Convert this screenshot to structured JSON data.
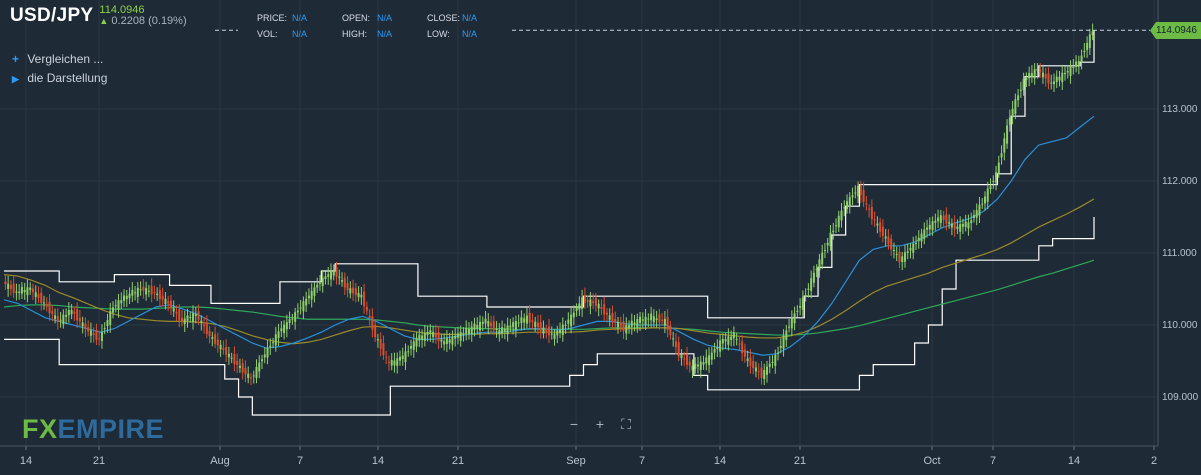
{
  "header": {
    "symbol": "USD/JPY",
    "last_price": "114.0946",
    "change": "0.2208 (0.19%)",
    "fields": [
      {
        "label": "PRICE:",
        "value": "N/A"
      },
      {
        "label": "OPEN:",
        "value": "N/A"
      },
      {
        "label": "CLOSE:",
        "value": "N/A"
      },
      {
        "label": "VOL:",
        "value": "N/A"
      },
      {
        "label": "HIGH:",
        "value": "N/A"
      },
      {
        "label": "LOW:",
        "value": "N/A"
      }
    ]
  },
  "menu": {
    "compare": "Vergleichen ...",
    "display": "die Darstellung"
  },
  "logo": {
    "fx": "FX",
    "empire": "EMPIRE"
  },
  "zoom": {
    "minus": "−",
    "plus": "+",
    "fullscreen": "⛶"
  },
  "price_tag": "114.0946",
  "colors": {
    "background": "#1e2a36",
    "up": "#8fcf6a",
    "down": "#d9502f",
    "ma_fast": "#2c8fd6",
    "ma_mid": "#9a8a2c",
    "ma_slow": "#2fa85a",
    "channel": "#ffffff",
    "accent": "#6dbb45"
  },
  "chart_data": {
    "type": "candlestick",
    "title": "USD/JPY",
    "y_ticks": [
      "109.000",
      "110.000",
      "111.000",
      "112.000",
      "113.000"
    ],
    "y_range": [
      108.5,
      114.3
    ],
    "x_ticks": [
      "14",
      "21",
      "Aug",
      "7",
      "14",
      "21",
      "Sep",
      "7",
      "14",
      "21",
      "Oct",
      "7",
      "14",
      "2"
    ],
    "last": 114.0946,
    "grid": true,
    "series": [
      {
        "name": "Close",
        "values": [
          110.6,
          110.45,
          110.5,
          110.3,
          110.05,
          110.2,
          109.95,
          109.8,
          110.25,
          110.4,
          110.5,
          110.45,
          110.3,
          110.05,
          110.15,
          109.85,
          109.65,
          109.45,
          109.25,
          109.6,
          109.9,
          110.1,
          110.35,
          110.6,
          110.75,
          110.5,
          110.4,
          109.85,
          109.45,
          109.55,
          109.8,
          109.9,
          109.75,
          109.85,
          109.95,
          110.05,
          109.9,
          110.0,
          110.1,
          109.95,
          109.85,
          110.05,
          110.35,
          110.3,
          110.1,
          109.95,
          110.05,
          110.1,
          110.05,
          109.6,
          109.4,
          109.5,
          109.75,
          109.85,
          109.5,
          109.3,
          109.55,
          110.0,
          110.35,
          110.8,
          111.25,
          111.65,
          111.9,
          111.5,
          111.2,
          110.9,
          111.1,
          111.35,
          111.5,
          111.35,
          111.4,
          111.7,
          112.1,
          112.9,
          113.4,
          113.55,
          113.35,
          113.5,
          113.65,
          114.09
        ]
      },
      {
        "name": "MA fast",
        "values": [
          110.35,
          110.3,
          110.2,
          110.1,
          110.05,
          110.0,
          109.95,
          109.9,
          109.95,
          110.05,
          110.15,
          110.25,
          110.28,
          110.22,
          110.15,
          110.05,
          109.95,
          109.85,
          109.75,
          109.68,
          109.7,
          109.75,
          109.82,
          109.9,
          110.0,
          110.08,
          110.12,
          110.05,
          109.95,
          109.85,
          109.8,
          109.8,
          109.82,
          109.85,
          109.88,
          109.9,
          109.9,
          109.92,
          109.95,
          109.95,
          109.93,
          109.95,
          110.0,
          110.05,
          110.05,
          110.02,
          110.0,
          110.0,
          110.0,
          109.9,
          109.8,
          109.72,
          109.68,
          109.66,
          109.62,
          109.58,
          109.6,
          109.7,
          109.85,
          110.05,
          110.3,
          110.6,
          110.9,
          111.05,
          111.1,
          111.1,
          111.15,
          111.25,
          111.35,
          111.42,
          111.48,
          111.58,
          111.75,
          112.0,
          112.3,
          112.5,
          112.55,
          112.6,
          112.75,
          112.9
        ]
      },
      {
        "name": "MA mid",
        "values": [
          110.7,
          110.68,
          110.62,
          110.55,
          110.45,
          110.38,
          110.3,
          110.22,
          110.15,
          110.1,
          110.08,
          110.06,
          110.05,
          110.05,
          110.04,
          110.02,
          109.98,
          109.92,
          109.85,
          109.8,
          109.76,
          109.74,
          109.76,
          109.8,
          109.86,
          109.92,
          109.97,
          109.98,
          109.96,
          109.93,
          109.9,
          109.88,
          109.87,
          109.87,
          109.87,
          109.88,
          109.88,
          109.89,
          109.9,
          109.9,
          109.9,
          109.9,
          109.91,
          109.93,
          109.94,
          109.95,
          109.95,
          109.96,
          109.96,
          109.95,
          109.92,
          109.89,
          109.87,
          109.85,
          109.83,
          109.82,
          109.82,
          109.85,
          109.9,
          109.98,
          110.08,
          110.2,
          110.33,
          110.45,
          110.54,
          110.6,
          110.66,
          110.72,
          110.8,
          110.86,
          110.92,
          110.98,
          111.05,
          111.14,
          111.25,
          111.36,
          111.45,
          111.54,
          111.64,
          111.75
        ]
      },
      {
        "name": "MA slow",
        "values": [
          110.25,
          110.27,
          110.28,
          110.28,
          110.27,
          110.25,
          110.24,
          110.23,
          110.22,
          110.22,
          110.22,
          110.23,
          110.24,
          110.25,
          110.25,
          110.24,
          110.22,
          110.2,
          110.18,
          110.15,
          110.12,
          110.1,
          110.08,
          110.08,
          110.08,
          110.08,
          110.08,
          110.07,
          110.05,
          110.03,
          110.0,
          109.98,
          109.97,
          109.96,
          109.95,
          109.95,
          109.95,
          109.94,
          109.94,
          109.94,
          109.94,
          109.94,
          109.94,
          109.95,
          109.96,
          109.96,
          109.96,
          109.96,
          109.96,
          109.95,
          109.94,
          109.92,
          109.9,
          109.89,
          109.88,
          109.87,
          109.86,
          109.86,
          109.87,
          109.89,
          109.92,
          109.95,
          109.99,
          110.04,
          110.09,
          110.14,
          110.19,
          110.24,
          110.29,
          110.34,
          110.39,
          110.44,
          110.49,
          110.55,
          110.61,
          110.67,
          110.72,
          110.78,
          110.84,
          110.9
        ]
      },
      {
        "name": "Upper",
        "values": [
          110.75,
          110.75,
          110.75,
          110.75,
          110.6,
          110.6,
          110.6,
          110.6,
          110.7,
          110.7,
          110.7,
          110.7,
          110.55,
          110.55,
          110.55,
          110.3,
          110.3,
          110.3,
          110.3,
          110.3,
          110.6,
          110.6,
          110.6,
          110.75,
          110.85,
          110.85,
          110.85,
          110.85,
          110.85,
          110.85,
          110.4,
          110.4,
          110.4,
          110.4,
          110.4,
          110.25,
          110.25,
          110.25,
          110.25,
          110.25,
          110.25,
          110.25,
          110.4,
          110.4,
          110.4,
          110.4,
          110.4,
          110.4,
          110.4,
          110.4,
          110.4,
          110.1,
          110.1,
          110.1,
          110.1,
          110.1,
          110.1,
          110.1,
          110.4,
          110.8,
          111.25,
          111.65,
          111.95,
          111.95,
          111.95,
          111.95,
          111.95,
          111.95,
          111.95,
          111.95,
          111.95,
          111.95,
          112.1,
          112.9,
          113.45,
          113.6,
          113.6,
          113.6,
          113.65,
          114.09
        ]
      },
      {
        "name": "Lower",
        "values": [
          109.8,
          109.8,
          109.8,
          109.8,
          109.45,
          109.45,
          109.45,
          109.45,
          109.45,
          109.45,
          109.45,
          109.45,
          109.45,
          109.45,
          109.45,
          109.45,
          109.25,
          109.0,
          108.75,
          108.75,
          108.75,
          108.75,
          108.75,
          108.75,
          108.75,
          108.75,
          108.75,
          108.75,
          109.15,
          109.15,
          109.15,
          109.15,
          109.15,
          109.15,
          109.15,
          109.15,
          109.15,
          109.15,
          109.15,
          109.15,
          109.15,
          109.3,
          109.45,
          109.6,
          109.6,
          109.6,
          109.6,
          109.6,
          109.6,
          109.6,
          109.3,
          109.1,
          109.1,
          109.1,
          109.1,
          109.1,
          109.1,
          109.1,
          109.1,
          109.1,
          109.1,
          109.1,
          109.3,
          109.45,
          109.45,
          109.45,
          109.75,
          110.0,
          110.5,
          110.9,
          110.9,
          110.9,
          110.9,
          110.9,
          110.9,
          111.1,
          111.2,
          111.2,
          111.2,
          111.5
        ]
      }
    ]
  }
}
